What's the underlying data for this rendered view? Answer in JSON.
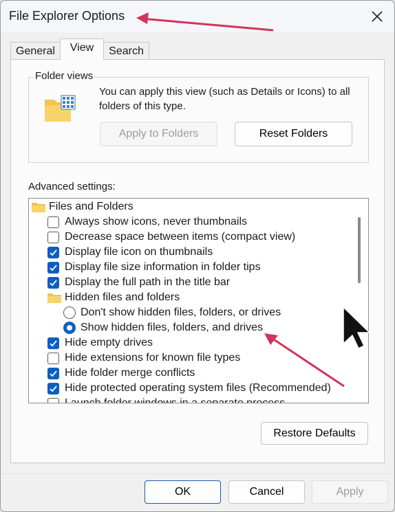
{
  "window": {
    "title": "File Explorer Options"
  },
  "tabs": [
    {
      "label": "General"
    },
    {
      "label": "View"
    },
    {
      "label": "Search"
    }
  ],
  "folder_views": {
    "group_label": "Folder views",
    "description": "You can apply this view (such as Details or Icons) to all folders of this type.",
    "apply_button": "Apply to Folders",
    "reset_button": "Reset Folders"
  },
  "advanced": {
    "label": "Advanced settings:",
    "items": [
      {
        "type": "folder",
        "label": "Files and Folders"
      },
      {
        "type": "checkbox",
        "label": "Always show icons, never thumbnails",
        "checked": false
      },
      {
        "type": "checkbox",
        "label": "Decrease space between items (compact view)",
        "checked": false
      },
      {
        "type": "checkbox",
        "label": "Display file icon on thumbnails",
        "checked": true
      },
      {
        "type": "checkbox",
        "label": "Display file size information in folder tips",
        "checked": true
      },
      {
        "type": "checkbox",
        "label": "Display the full path in the title bar",
        "checked": true
      },
      {
        "type": "folder",
        "label": "Hidden files and folders"
      },
      {
        "type": "radio",
        "label": "Don't show hidden files, folders, or drives",
        "checked": false
      },
      {
        "type": "radio",
        "label": "Show hidden files, folders, and drives",
        "checked": true
      },
      {
        "type": "checkbox",
        "label": "Hide empty drives",
        "checked": true
      },
      {
        "type": "checkbox",
        "label": "Hide extensions for known file types",
        "checked": false
      },
      {
        "type": "checkbox",
        "label": "Hide folder merge conflicts",
        "checked": true
      },
      {
        "type": "checkbox",
        "label": "Hide protected operating system files (Recommended)",
        "checked": true
      },
      {
        "type": "checkbox",
        "label": "Launch folder windows in a separate process",
        "checked": false
      }
    ],
    "restore_button": "Restore Defaults"
  },
  "footer": {
    "ok": "OK",
    "cancel": "Cancel",
    "apply": "Apply"
  },
  "colors": {
    "accent": "#0b5fc4",
    "annotation_arrow": "#d1345b"
  }
}
